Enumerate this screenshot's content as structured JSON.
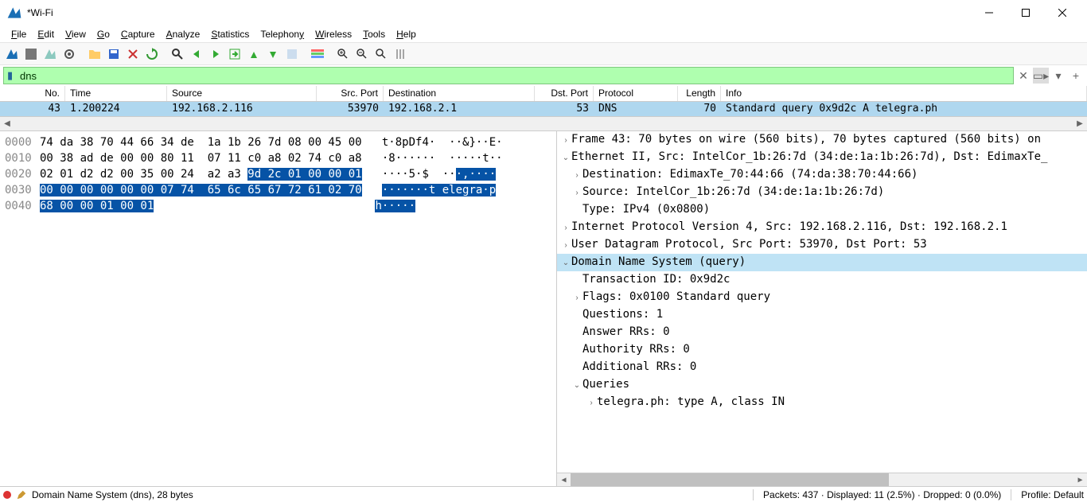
{
  "window": {
    "title": "*Wi-Fi"
  },
  "menu": [
    "File",
    "Edit",
    "View",
    "Go",
    "Capture",
    "Analyze",
    "Statistics",
    "Telephony",
    "Wireless",
    "Tools",
    "Help"
  ],
  "filter": {
    "value": "dns"
  },
  "columns": {
    "no": "No.",
    "time": "Time",
    "source": "Source",
    "sport": "Src. Port",
    "dest": "Destination",
    "dport": "Dst. Port",
    "proto": "Protocol",
    "len": "Length",
    "info": "Info"
  },
  "packet": {
    "no": "43",
    "time": "1.200224",
    "source": "192.168.2.116",
    "sport": "53970",
    "dest": "192.168.2.1",
    "dport": "53",
    "proto": "DNS",
    "len": "70",
    "info": "Standard query 0x9d2c A telegra.ph"
  },
  "hex": {
    "rows": [
      {
        "off": "0000",
        "b": "74 da 38 70 44 66 34 de  1a 1b 26 7d 08 00 45 00",
        "a": "t·8pDf4·  ··&}··E·"
      },
      {
        "off": "0010",
        "b": "00 38 ad de 00 00 80 11  07 11 c0 a8 02 74 c0 a8",
        "a": "·8······  ·····t··"
      },
      {
        "off": "0020",
        "b": "02 01 d2 d2 00 35 00 24  a2 a3 ",
        "a": "····5·$  ··",
        "sb": "9d 2c 01 00 00 01",
        "sa": "·,····"
      },
      {
        "off": "0030",
        "sb2": "00 00 00 00 00 00 07 74  65 6c 65 67 72 61 02 70",
        "sa2": "·······t elegra·p"
      },
      {
        "off": "0040",
        "sb3": "68 00 00 01 00 01",
        "sa3": "h·····"
      }
    ]
  },
  "tree": {
    "frame": "Frame 43: 70 bytes on wire (560 bits), 70 bytes captured (560 bits) on",
    "eth": "Ethernet II, Src: IntelCor_1b:26:7d (34:de:1a:1b:26:7d), Dst: EdimaxTe_",
    "eth_dst": "Destination: EdimaxTe_70:44:66 (74:da:38:70:44:66)",
    "eth_src": "Source: IntelCor_1b:26:7d (34:de:1a:1b:26:7d)",
    "eth_type": "Type: IPv4 (0x0800)",
    "ip": "Internet Protocol Version 4, Src: 192.168.2.116, Dst: 192.168.2.1",
    "udp": "User Datagram Protocol, Src Port: 53970, Dst Port: 53",
    "dns": "Domain Name System (query)",
    "dns_txid": "Transaction ID: 0x9d2c",
    "dns_flags": "Flags: 0x0100 Standard query",
    "dns_q": "Questions: 1",
    "dns_ans": "Answer RRs: 0",
    "dns_auth": "Authority RRs: 0",
    "dns_add": "Additional RRs: 0",
    "dns_queries": "Queries",
    "dns_query1": "telegra.ph: type A, class IN"
  },
  "status": {
    "field": "Domain Name System (dns), 28 bytes",
    "packets": "Packets: 437 · Displayed: 11 (2.5%) · Dropped: 0 (0.0%)",
    "profile": "Profile: Default"
  }
}
